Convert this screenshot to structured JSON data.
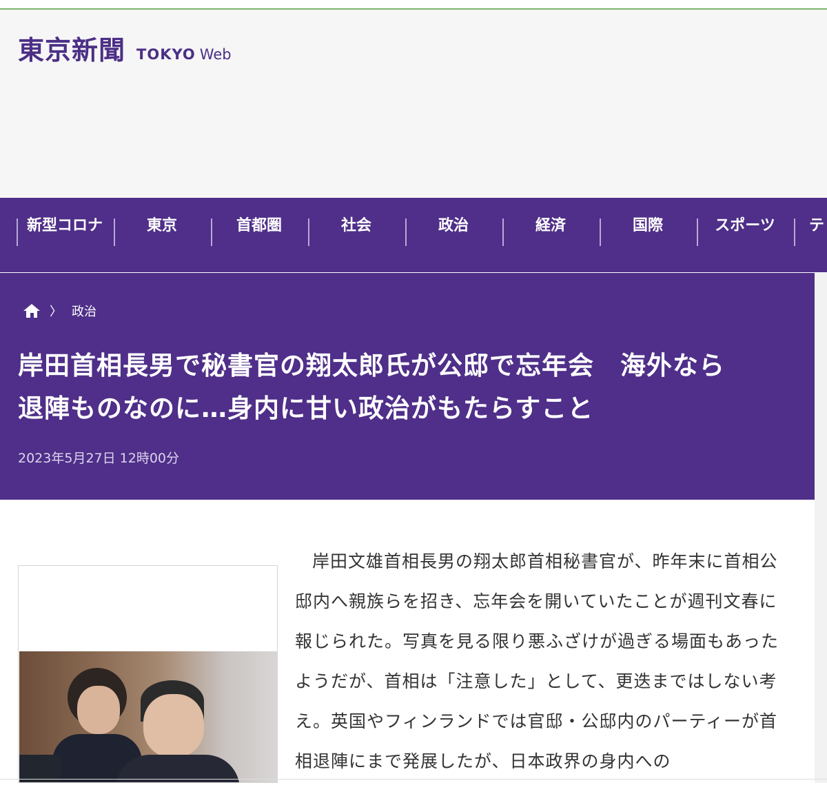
{
  "header": {
    "logo_jp": "東京新聞",
    "logo_tokyo": "TOKYO",
    "logo_web": "Web"
  },
  "nav": {
    "items": [
      {
        "label": "新型コロナ"
      },
      {
        "label": "東京"
      },
      {
        "label": "首都圏"
      },
      {
        "label": "社会"
      },
      {
        "label": "政治"
      },
      {
        "label": "経済"
      },
      {
        "label": "国際"
      },
      {
        "label": "スポーツ"
      },
      {
        "label": "テ"
      }
    ]
  },
  "breadcrumb": {
    "home_icon": "home-icon",
    "separator": "〉",
    "category": "政治"
  },
  "article": {
    "headline_line1": "岸田首相長男で秘書官の翔太郎氏が公邸で忘年会　海外なら",
    "headline_line2": "退陣ものなのに…身内に甘い政治がもたらすこと",
    "date": "2023年5月27日 12時00分",
    "body": "岸田文雄首相長男の翔太郎首相秘書官が、昨年末に首相公邸内へ親族らを招き、忘年会を開いていたことが週刊文春に報じられた。写真を見る限り悪ふざけが過ぎる場面もあったようだが、首相は「注意した」として、更迭まではしない考え。英国やフィンランドでは官邸・公邸内のパーティーが首相退陣にまで発展したが、日本政界の身内への"
  },
  "colors": {
    "brand_purple": "#4f2f89",
    "logo_purple": "#4b2f86",
    "top_line_green": "#7ab56a"
  }
}
